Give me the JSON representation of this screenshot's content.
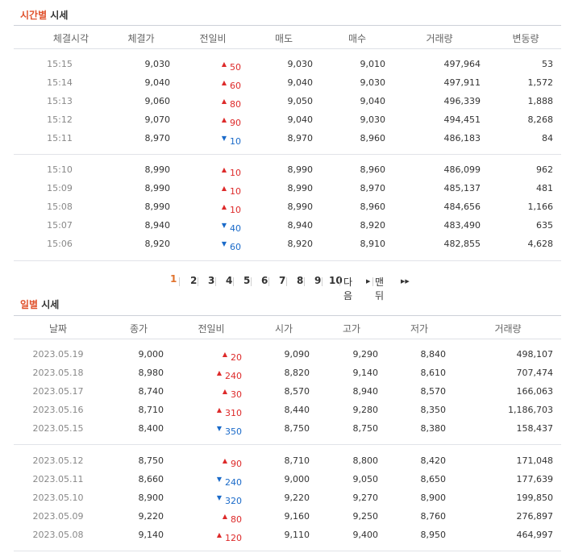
{
  "time_section": {
    "title_accent": "시간별",
    "title_rest": " 시세",
    "headers": [
      "체결시각",
      "체결가",
      "전일비",
      "매도",
      "매수",
      "거래량",
      "변동량"
    ],
    "groups": [
      [
        {
          "time": "15:15",
          "price": "9,030",
          "dir": "up",
          "change": "50",
          "ask": "9,030",
          "bid": "9,010",
          "volume": "497,964",
          "delta": "53"
        },
        {
          "time": "15:14",
          "price": "9,040",
          "dir": "up",
          "change": "60",
          "ask": "9,040",
          "bid": "9,030",
          "volume": "497,911",
          "delta": "1,572"
        },
        {
          "time": "15:13",
          "price": "9,060",
          "dir": "up",
          "change": "80",
          "ask": "9,050",
          "bid": "9,040",
          "volume": "496,339",
          "delta": "1,888"
        },
        {
          "time": "15:12",
          "price": "9,070",
          "dir": "up",
          "change": "90",
          "ask": "9,040",
          "bid": "9,030",
          "volume": "494,451",
          "delta": "8,268"
        },
        {
          "time": "15:11",
          "price": "8,970",
          "dir": "down",
          "change": "10",
          "ask": "8,970",
          "bid": "8,960",
          "volume": "486,183",
          "delta": "84"
        }
      ],
      [
        {
          "time": "15:10",
          "price": "8,990",
          "dir": "up",
          "change": "10",
          "ask": "8,990",
          "bid": "8,960",
          "volume": "486,099",
          "delta": "962"
        },
        {
          "time": "15:09",
          "price": "8,990",
          "dir": "up",
          "change": "10",
          "ask": "8,990",
          "bid": "8,970",
          "volume": "485,137",
          "delta": "481"
        },
        {
          "time": "15:08",
          "price": "8,990",
          "dir": "up",
          "change": "10",
          "ask": "8,990",
          "bid": "8,960",
          "volume": "484,656",
          "delta": "1,166"
        },
        {
          "time": "15:07",
          "price": "8,940",
          "dir": "down",
          "change": "40",
          "ask": "8,940",
          "bid": "8,920",
          "volume": "483,490",
          "delta": "635"
        },
        {
          "time": "15:06",
          "price": "8,920",
          "dir": "down",
          "change": "60",
          "ask": "8,920",
          "bid": "8,910",
          "volume": "482,855",
          "delta": "4,628"
        }
      ]
    ]
  },
  "pagination": {
    "current": "1",
    "pages": [
      "2",
      "3",
      "4",
      "5",
      "6",
      "7",
      "8",
      "9",
      "10"
    ],
    "next_label": "다음",
    "last_label": "맨뒤"
  },
  "daily_section": {
    "title_accent": "일별",
    "title_rest": " 시세",
    "headers": [
      "날짜",
      "종가",
      "전일비",
      "시가",
      "고가",
      "저가",
      "거래량"
    ],
    "groups": [
      [
        {
          "date": "2023.05.19",
          "close": "9,000",
          "dir": "up",
          "change": "20",
          "open": "9,090",
          "high": "9,290",
          "low": "8,840",
          "volume": "498,107"
        },
        {
          "date": "2023.05.18",
          "close": "8,980",
          "dir": "up",
          "change": "240",
          "open": "8,820",
          "high": "9,140",
          "low": "8,610",
          "volume": "707,474"
        },
        {
          "date": "2023.05.17",
          "close": "8,740",
          "dir": "up",
          "change": "30",
          "open": "8,570",
          "high": "8,940",
          "low": "8,570",
          "volume": "166,063"
        },
        {
          "date": "2023.05.16",
          "close": "8,710",
          "dir": "up",
          "change": "310",
          "open": "8,440",
          "high": "9,280",
          "low": "8,350",
          "volume": "1,186,703"
        },
        {
          "date": "2023.05.15",
          "close": "8,400",
          "dir": "down",
          "change": "350",
          "open": "8,750",
          "high": "8,750",
          "low": "8,380",
          "volume": "158,437"
        }
      ],
      [
        {
          "date": "2023.05.12",
          "close": "8,750",
          "dir": "up",
          "change": "90",
          "open": "8,710",
          "high": "8,800",
          "low": "8,420",
          "volume": "171,048"
        },
        {
          "date": "2023.05.11",
          "close": "8,660",
          "dir": "down",
          "change": "240",
          "open": "9,000",
          "high": "9,050",
          "low": "8,650",
          "volume": "177,639"
        },
        {
          "date": "2023.05.10",
          "close": "8,900",
          "dir": "down",
          "change": "320",
          "open": "9,220",
          "high": "9,270",
          "low": "8,900",
          "volume": "199,850"
        },
        {
          "date": "2023.05.09",
          "close": "9,220",
          "dir": "up",
          "change": "80",
          "open": "9,160",
          "high": "9,250",
          "low": "8,760",
          "volume": "276,897"
        },
        {
          "date": "2023.05.08",
          "close": "9,140",
          "dir": "up",
          "change": "120",
          "open": "9,110",
          "high": "9,400",
          "low": "8,950",
          "volume": "464,997"
        }
      ]
    ]
  },
  "colors": {
    "accent": "#e0522d",
    "up": "#dd2a2a",
    "down": "#1a6ac9",
    "current_page": "#e0722d"
  }
}
